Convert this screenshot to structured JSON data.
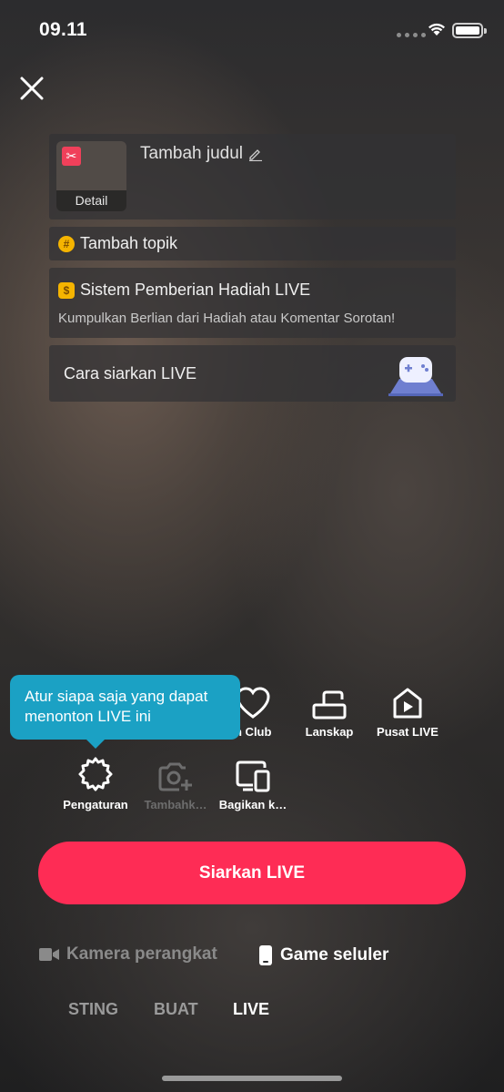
{
  "status_bar": {
    "time": "09.11"
  },
  "setup": {
    "thumbnail_label": "Detail",
    "title_placeholder": "Tambah judul",
    "topic_label": "Tambah topik",
    "gift_title": "Sistem Pemberian Hadiah LIVE",
    "gift_subtitle": "Kumpulkan Berlian dari Hadiah atau Komentar Sorotan!",
    "how_to_label": "Cara siarkan LIVE"
  },
  "tooltip": {
    "text": "Atur siapa saja yang dapat menonton LIVE ini"
  },
  "tools": {
    "fan_club": "n Club",
    "landscape": "Lanskap",
    "live_center": "Pusat LIVE",
    "settings": "Pengaturan",
    "add_camera": "Tambahk…",
    "share": "Bagikan k…"
  },
  "primary_button": "Siarkan LIVE",
  "source_modes": {
    "device_camera": "Kamera perangkat",
    "mobile_game": "Game seluler"
  },
  "tabs": {
    "posting": "STING",
    "create": "BUAT",
    "live": "LIVE"
  },
  "colors": {
    "accent": "#fe2c55",
    "tooltip": "#1ba1c4"
  }
}
